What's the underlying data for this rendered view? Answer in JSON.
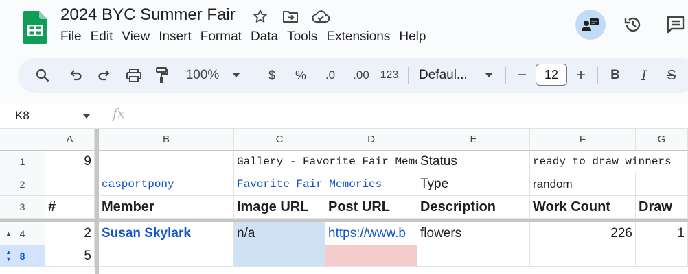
{
  "document": {
    "title": "2024 BYC Summer Fair"
  },
  "colors": {
    "brand_green": "#0f9d58",
    "selected_row": "#d3e3fd",
    "blue_fill": "#cfe2f3",
    "pink_fill": "#f4cccc",
    "link": "#1155cc"
  },
  "menu": [
    "File",
    "Edit",
    "View",
    "Insert",
    "Format",
    "Data",
    "Tools",
    "Extensions",
    "Help"
  ],
  "toolbar": {
    "zoom": "100%",
    "currency": "$",
    "percent": "%",
    "decrease_decimal": ".0",
    "increase_decimal": ".00",
    "number_format": "123",
    "font": "Defaul...",
    "font_size": "12",
    "minus": "−",
    "plus": "+",
    "bold": "B",
    "italic": "I",
    "strike": "S"
  },
  "formula_bar": {
    "name_box": "K8",
    "fx": "fx"
  },
  "grid": {
    "columns": [
      "A",
      "B",
      "C",
      "D",
      "E",
      "F",
      "G"
    ],
    "rows": [
      {
        "num": "1",
        "cells": {
          "A": "9",
          "B": "",
          "C": "Gallery - Favorite Fair Memories",
          "E": "Status",
          "F": "ready to draw winners"
        }
      },
      {
        "num": "2",
        "cells": {
          "A": "",
          "B": "casportpony",
          "C": "Favorite Fair Memories",
          "E": "Type",
          "F": "random"
        }
      },
      {
        "num": "3",
        "cells": {
          "A": "#",
          "B": "Member",
          "C": "Image URL",
          "D": "Post URL",
          "E": "Description",
          "F": "Work Count",
          "G": "Draw"
        }
      },
      {
        "num": "4",
        "cells": {
          "A": "2",
          "B": "Susan Skylark",
          "C": "n/a",
          "D": "https://www.b",
          "E": "flowers",
          "F": "226",
          "G": "1"
        }
      },
      {
        "num": "8",
        "cells": {
          "A": "5"
        }
      }
    ]
  }
}
